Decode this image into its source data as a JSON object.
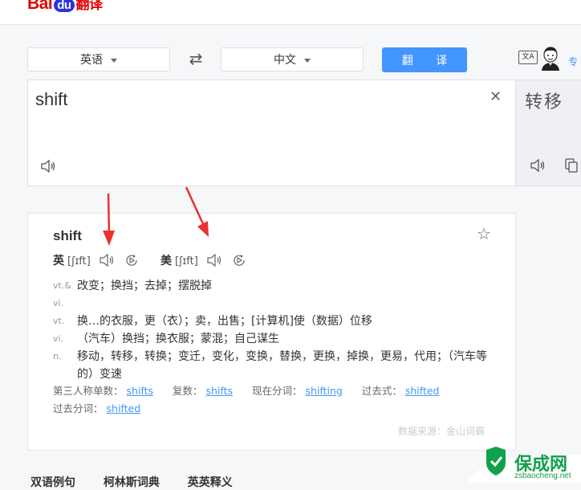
{
  "header": {
    "logo_bai": "Bai",
    "logo_du": "du",
    "logo_fanyi": "翻译"
  },
  "lang_bar": {
    "source_lang": "英语",
    "target_lang": "中文",
    "translate_button": "翻 译",
    "xa_icon_text": "文A",
    "side_link": "专"
  },
  "input": {
    "text": "shift"
  },
  "output": {
    "text": "转移"
  },
  "dict": {
    "word": "shift",
    "uk_label": "英",
    "uk_phonetic": "[ʃɪft]",
    "us_label": "美",
    "us_phonetic": "[ʃɪft]",
    "definitions": [
      {
        "pos": "vt.& vi.",
        "text": "改变；换挡；去掉；摆脱掉"
      },
      {
        "pos": "vt.",
        "text": "换…的衣服，更（衣）；卖，出售；[计算机]使（数据）位移"
      },
      {
        "pos": "vi.",
        "text": "（汽车）换挡；换衣服；蒙混；自己谋生"
      },
      {
        "pos": "n.",
        "text": "移动，转移，转换；变迁，变化，变换，替换，更换，掉换，更易，代用；（汽车等的）变速"
      }
    ],
    "forms": {
      "third_person_label": "第三人称单数：",
      "third_person": "shifts",
      "plural_label": "复数：",
      "plural": "shifts",
      "present_participle_label": "现在分词：",
      "present_participle": "shifting",
      "past_tense_label": "过去式：",
      "past_tense": "shifted",
      "past_participle_label": "过去分词：",
      "past_participle": "shifted"
    },
    "source": "数据来源：金山词霸"
  },
  "bottom_tabs": [
    "双语例句",
    "柯林斯词典",
    "英英释义"
  ],
  "watermark": {
    "name": "保成网",
    "url": "zsbaocheng.net"
  },
  "colors": {
    "accent": "#4395ff",
    "logo_red": "#e10602",
    "arrow": "#e8322e",
    "watermark": "#12a14b"
  }
}
